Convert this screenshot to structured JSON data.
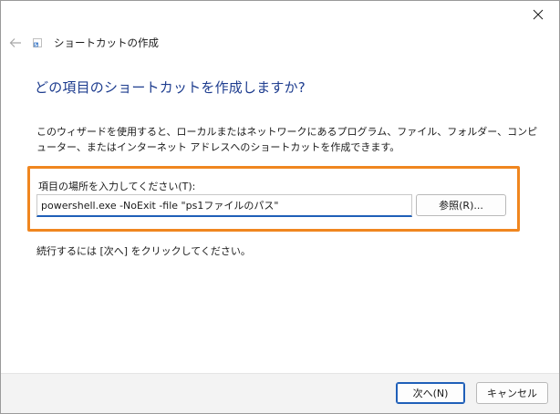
{
  "window": {
    "title": "ショートカットの作成"
  },
  "main": {
    "heading": "どの項目のショートカットを作成しますか?",
    "description": "このウィザードを使用すると、ローカルまたはネットワークにあるプログラム、ファイル、フォルダー、コンピューター、またはインターネット アドレスへのショートカットを作成できます。",
    "field_label": "項目の場所を入力してください(T):",
    "field_value": "powershell.exe -NoExit -file \"ps1ファイルのパス\"",
    "browse_label": "参照(R)...",
    "continue_text": "続行するには [次へ] をクリックしてください。"
  },
  "footer": {
    "next_label": "次へ(N)",
    "cancel_label": "キャンセル"
  },
  "icons": {
    "close": "close-icon",
    "back": "back-arrow-icon",
    "app": "shortcut-icon"
  },
  "colors": {
    "heading": "#1e3d8f",
    "highlight": "#f0861f",
    "accent": "#1f5fb8",
    "footer_bg": "#f3f3f3"
  }
}
